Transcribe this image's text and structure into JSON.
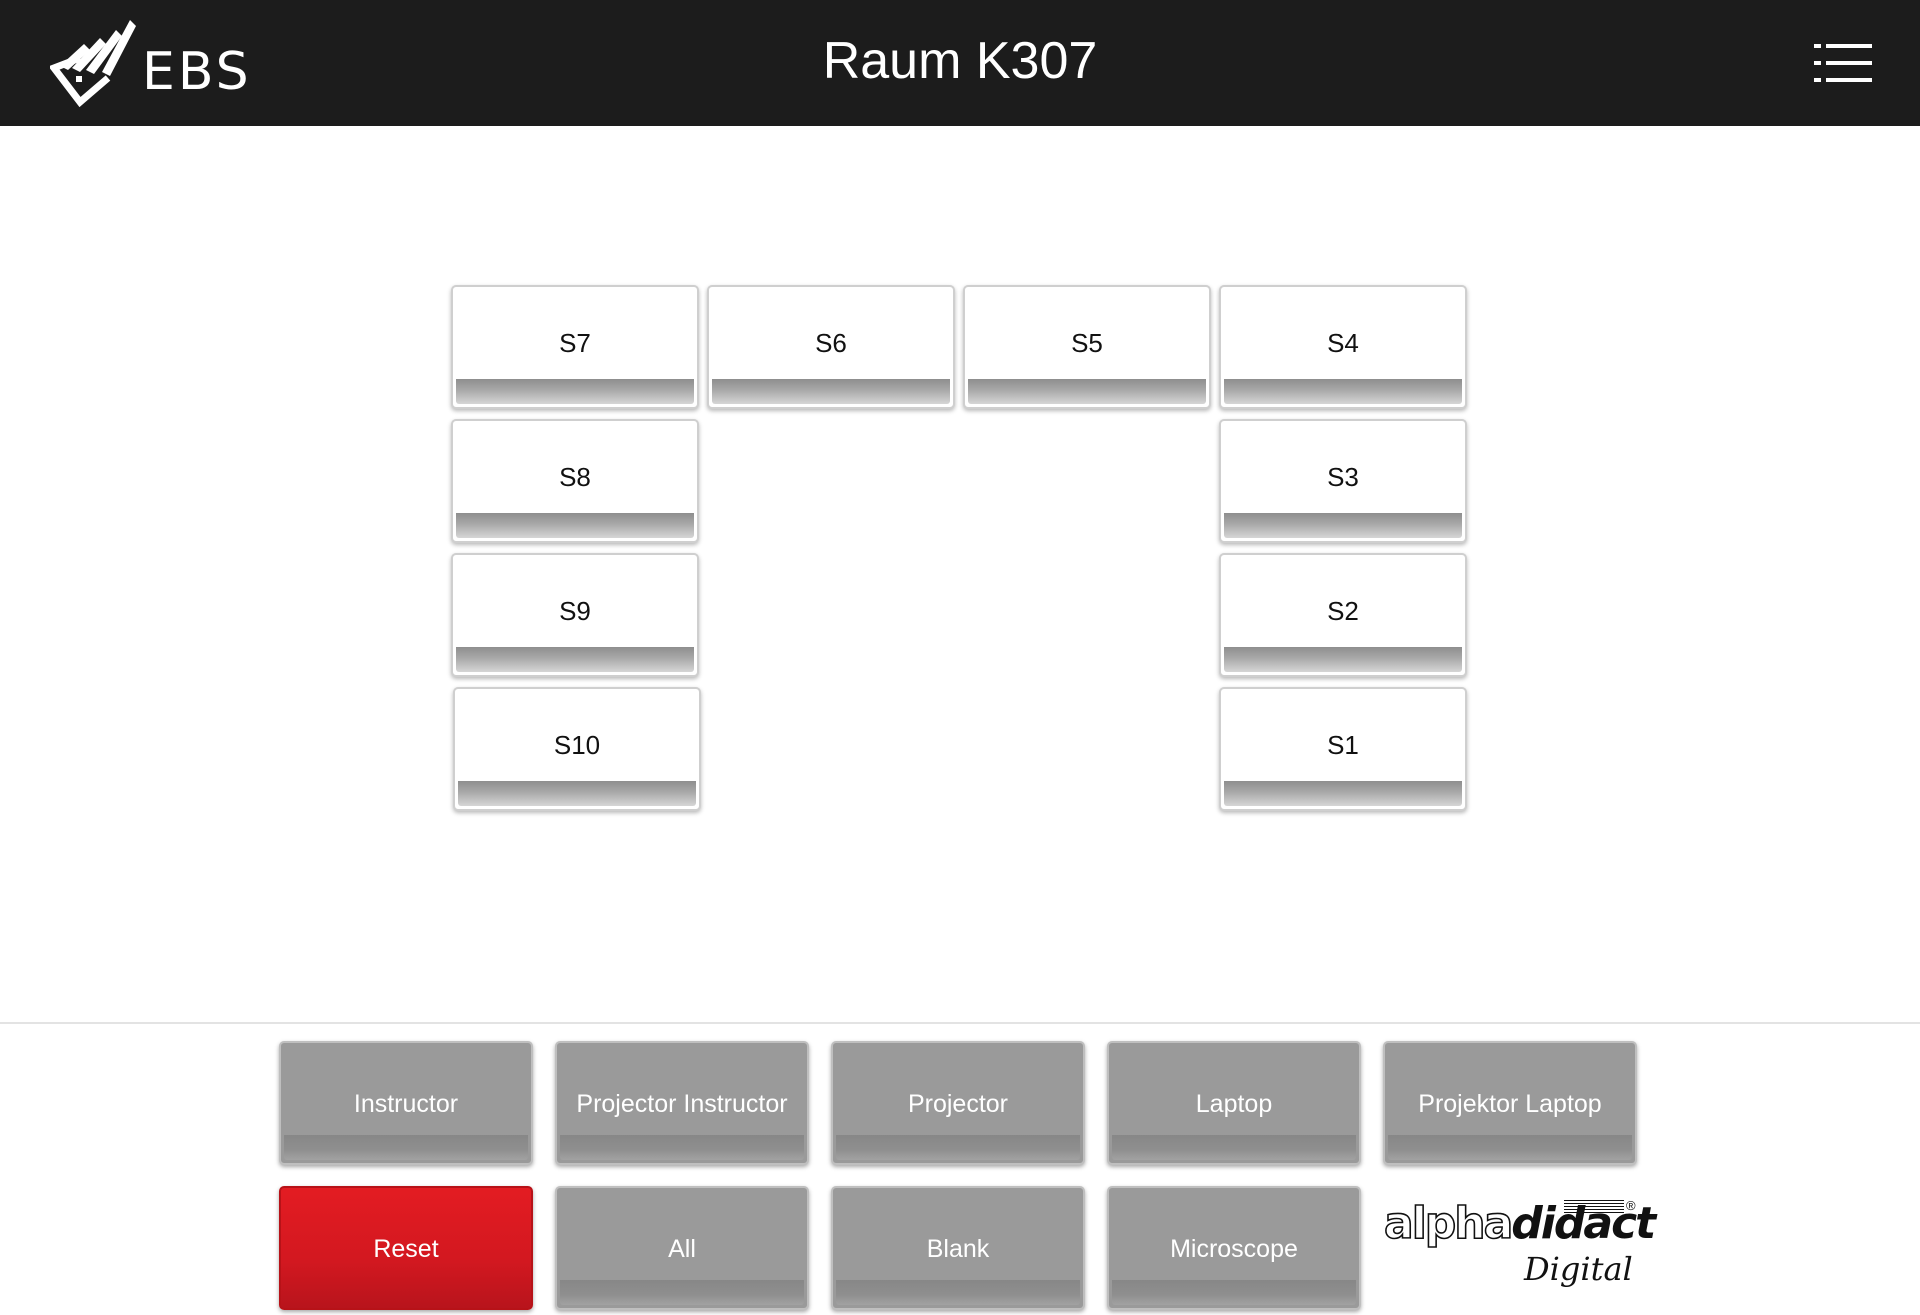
{
  "header": {
    "logo_text": "EBS",
    "title": "Raum K307",
    "menu_icon": "list-menu-icon"
  },
  "seats": {
    "s7": "S7",
    "s6": "S6",
    "s5": "S5",
    "s4": "S4",
    "s8": "S8",
    "s3": "S3",
    "s9": "S9",
    "s2": "S2",
    "s10": "S10",
    "s1": "S1"
  },
  "controls": {
    "instructor": "Instructor",
    "projector_instructor": "Projector Instructor",
    "projector": "Projector",
    "laptop": "Laptop",
    "projektor_laptop": "Projektor Laptop",
    "reset": "Reset",
    "all": "All",
    "blank": "Blank",
    "microscope": "Microscope"
  },
  "brand": {
    "name_light": "alpha",
    "name_bold": "didact",
    "registered": "®",
    "sub": "Digital"
  },
  "colors": {
    "header_bg": "#1c1c1c",
    "button_gray": "#9a9a9a",
    "reset_red": "#d31820"
  }
}
